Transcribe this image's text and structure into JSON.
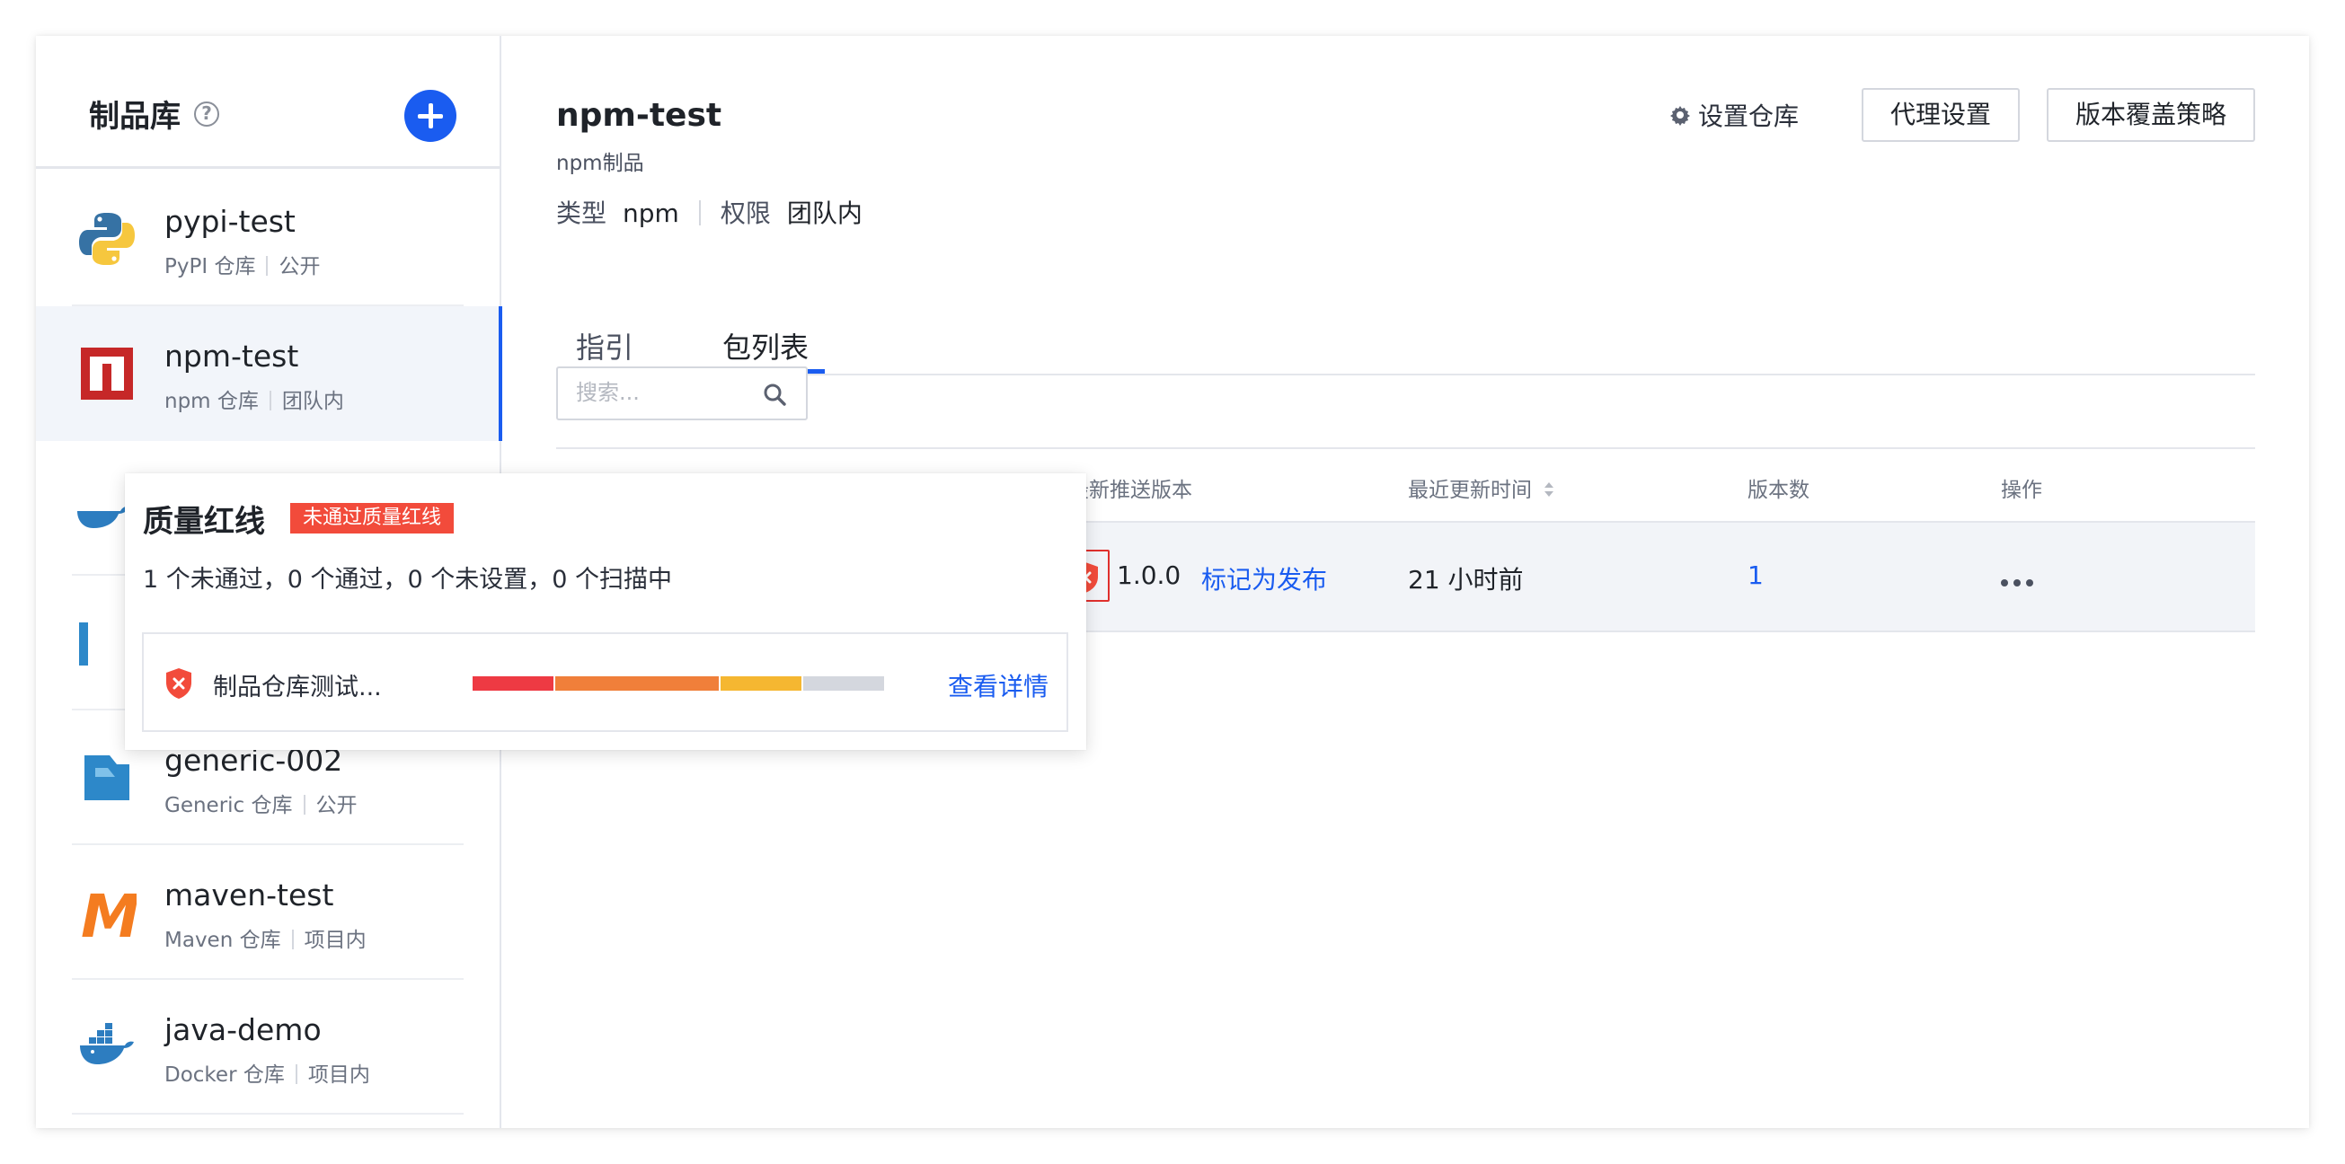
{
  "sidebar": {
    "title": "制品库",
    "help": "?",
    "repos": [
      {
        "name": "pypi-test",
        "type": "PyPI 仓库",
        "scope": "公开",
        "icon": "python-icon"
      },
      {
        "name": "npm-test",
        "type": "npm 仓库",
        "scope": "团队内",
        "icon": "npm-icon",
        "active": true
      },
      {
        "name": "",
        "type": "",
        "scope": "",
        "icon": "docker-icon"
      },
      {
        "name": "",
        "type": "",
        "scope": "",
        "icon": "generic-icon"
      },
      {
        "name": "generic-002",
        "type": "Generic 仓库",
        "scope": "公开",
        "icon": "generic-icon"
      },
      {
        "name": "maven-test",
        "type": "Maven 仓库",
        "scope": "项目内",
        "icon": "maven-icon"
      },
      {
        "name": "java-demo",
        "type": "Docker 仓库",
        "scope": "项目内",
        "icon": "docker-icon"
      }
    ]
  },
  "main": {
    "title": "npm-test",
    "subtitle": "npm制品",
    "type_label": "类型",
    "type_value": "npm",
    "perm_label": "权限",
    "perm_value": "团队内",
    "actions": {
      "settings": "设置仓库",
      "proxy": "代理设置",
      "override": "版本覆盖策略"
    },
    "tabs": [
      {
        "label": "指引"
      },
      {
        "label": "包列表",
        "active": true
      }
    ],
    "search": {
      "placeholder": "搜索..."
    },
    "table": {
      "headers": [
        "最新推送版本",
        "最近更新时间",
        "版本数",
        "操作"
      ],
      "rows": [
        {
          "version": "1.0.0",
          "mark": "标记为发布",
          "updated": "21 小时前",
          "count": "1"
        }
      ]
    }
  },
  "popup": {
    "title": "质量红线",
    "badge": "未通过质量红线",
    "summary": "1 个未通过，0 个通过，0 个未设置，0 个扫描中",
    "item": {
      "name": "制品仓库测试...",
      "link": "查看详情",
      "bar": [
        {
          "color": "#ee3a43",
          "fraction": 0.2
        },
        {
          "color": "#f07f3a",
          "fraction": 0.4
        },
        {
          "color": "#f5b731",
          "fraction": 0.2
        },
        {
          "color": "#d4d7de",
          "fraction": 0.2
        }
      ]
    }
  },
  "colors": {
    "accent": "#1a5cf0",
    "danger": "#f24b3b"
  }
}
